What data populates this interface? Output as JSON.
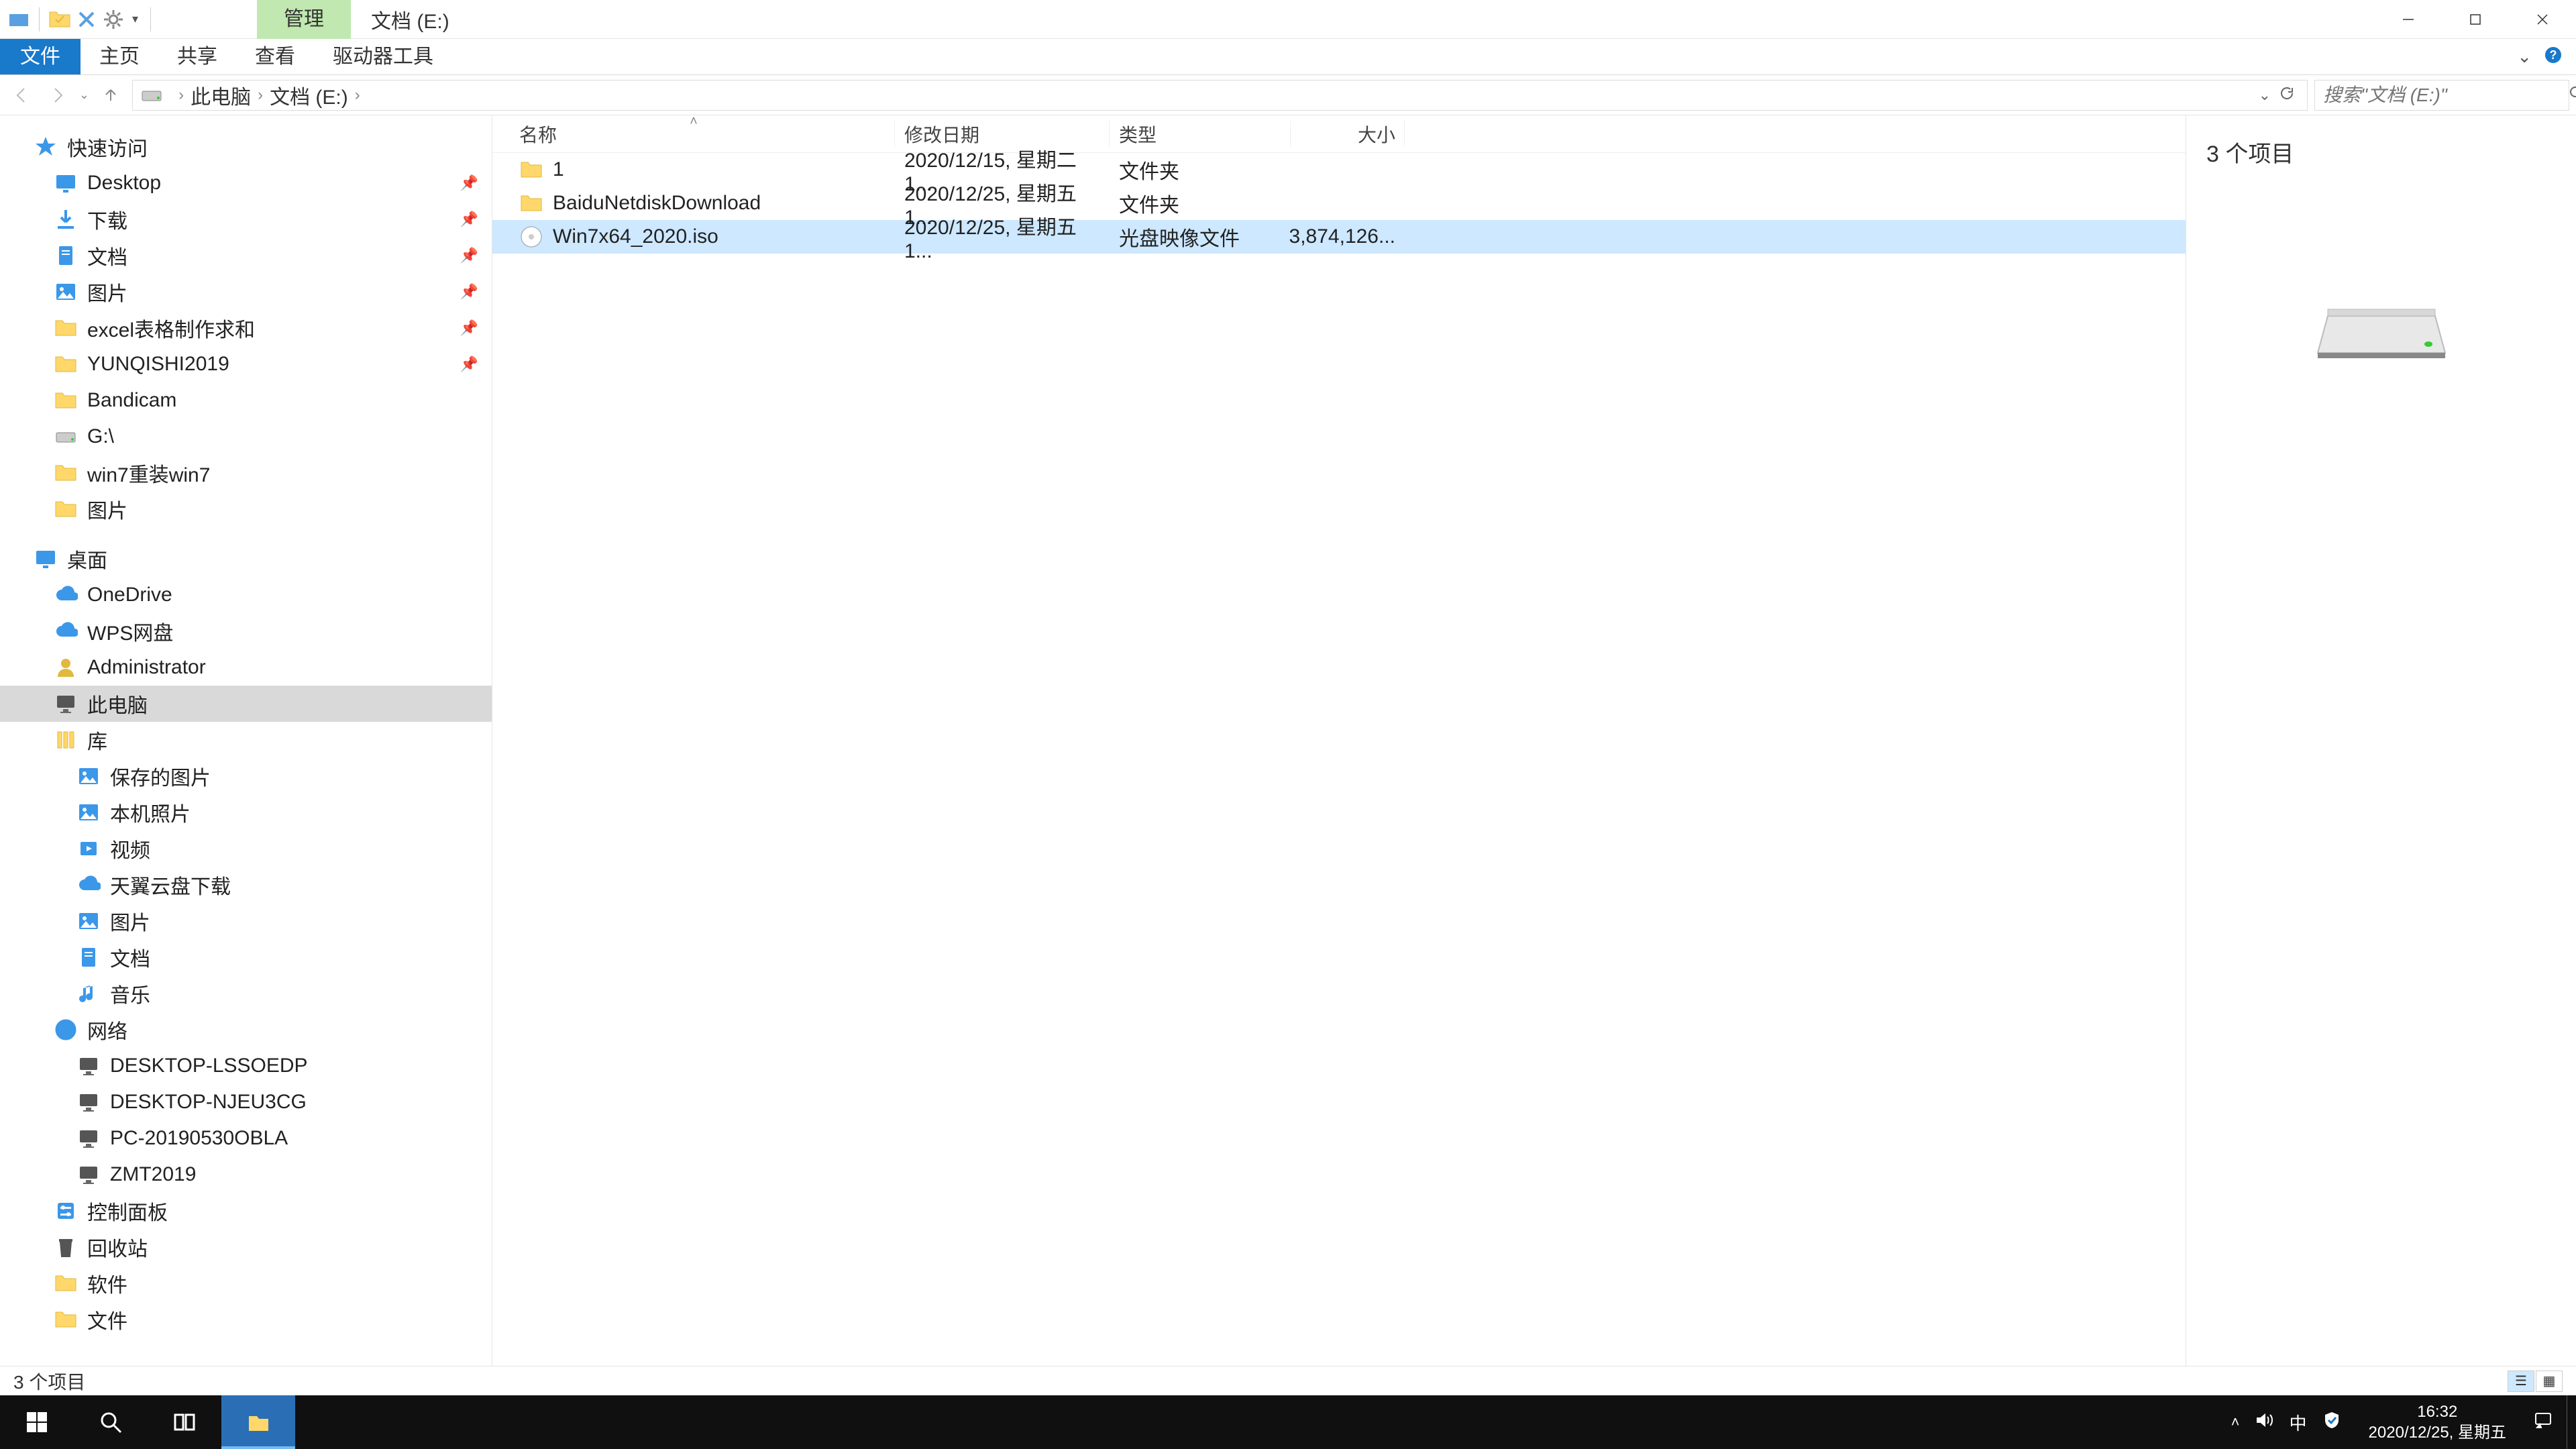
{
  "titlebar": {
    "ribbon_context": "管理",
    "title": "文档 (E:)",
    "qat": [
      "folder-check-icon",
      "close-icon",
      "settings-icon"
    ]
  },
  "ribbon": {
    "file": "文件",
    "tabs": [
      "主页",
      "共享",
      "查看",
      "驱动器工具"
    ]
  },
  "address": {
    "crumbs": [
      "此电脑",
      "文档 (E:)"
    ],
    "search_placeholder": "搜索\"文档 (E:)\""
  },
  "nav": {
    "quick_access": "快速访问",
    "quick_items": [
      {
        "label": "Desktop",
        "pinned": true,
        "icon": "desktop-icon"
      },
      {
        "label": "下载",
        "pinned": true,
        "icon": "download-icon"
      },
      {
        "label": "文档",
        "pinned": true,
        "icon": "document-icon"
      },
      {
        "label": "图片",
        "pinned": true,
        "icon": "pictures-icon"
      },
      {
        "label": "excel表格制作求和",
        "pinned": true,
        "icon": "folder-icon"
      },
      {
        "label": "YUNQISHI2019",
        "pinned": true,
        "icon": "folder-icon"
      },
      {
        "label": "Bandicam",
        "pinned": false,
        "icon": "folder-icon"
      },
      {
        "label": "G:\\",
        "pinned": false,
        "icon": "drive-icon"
      },
      {
        "label": "win7重装win7",
        "pinned": false,
        "icon": "folder-icon"
      },
      {
        "label": "图片",
        "pinned": false,
        "icon": "folder-icon"
      }
    ],
    "desktop": "桌面",
    "desktop_items": [
      {
        "label": "OneDrive",
        "icon": "cloud-icon"
      },
      {
        "label": "WPS网盘",
        "icon": "cloud-icon"
      },
      {
        "label": "Administrator",
        "icon": "user-icon"
      },
      {
        "label": "此电脑",
        "icon": "pc-icon",
        "selected": true
      },
      {
        "label": "库",
        "icon": "library-icon"
      }
    ],
    "library_items": [
      {
        "label": "保存的图片",
        "icon": "pictures-icon"
      },
      {
        "label": "本机照片",
        "icon": "pictures-icon"
      },
      {
        "label": "视频",
        "icon": "video-icon"
      },
      {
        "label": "天翼云盘下载",
        "icon": "cloud-icon"
      },
      {
        "label": "图片",
        "icon": "pictures-icon"
      },
      {
        "label": "文档",
        "icon": "document-icon"
      },
      {
        "label": "音乐",
        "icon": "music-icon"
      }
    ],
    "network": "网络",
    "network_items": [
      {
        "label": "DESKTOP-LSSOEDP",
        "icon": "pc-icon"
      },
      {
        "label": "DESKTOP-NJEU3CG",
        "icon": "pc-icon"
      },
      {
        "label": "PC-20190530OBLA",
        "icon": "pc-icon"
      },
      {
        "label": "ZMT2019",
        "icon": "pc-icon"
      }
    ],
    "extra": [
      {
        "label": "控制面板",
        "icon": "cpanel-icon"
      },
      {
        "label": "回收站",
        "icon": "recycle-icon"
      },
      {
        "label": "软件",
        "icon": "folder-icon"
      },
      {
        "label": "文件",
        "icon": "folder-icon"
      }
    ]
  },
  "columns": {
    "name": "名称",
    "date": "修改日期",
    "type": "类型",
    "size": "大小"
  },
  "files": [
    {
      "name": "1",
      "date": "2020/12/15, 星期二 1...",
      "type": "文件夹",
      "size": "",
      "icon": "folder-icon",
      "selected": false
    },
    {
      "name": "BaiduNetdiskDownload",
      "date": "2020/12/25, 星期五 1...",
      "type": "文件夹",
      "size": "",
      "icon": "folder-icon",
      "selected": false
    },
    {
      "name": "Win7x64_2020.iso",
      "date": "2020/12/25, 星期五 1...",
      "type": "光盘映像文件",
      "size": "3,874,126...",
      "icon": "disc-icon",
      "selected": true
    }
  ],
  "preview": {
    "count": "3 个项目"
  },
  "status": {
    "text": "3 个项目"
  },
  "taskbar": {
    "time": "16:32",
    "date": "2020/12/25, 星期五",
    "ime": "中"
  }
}
